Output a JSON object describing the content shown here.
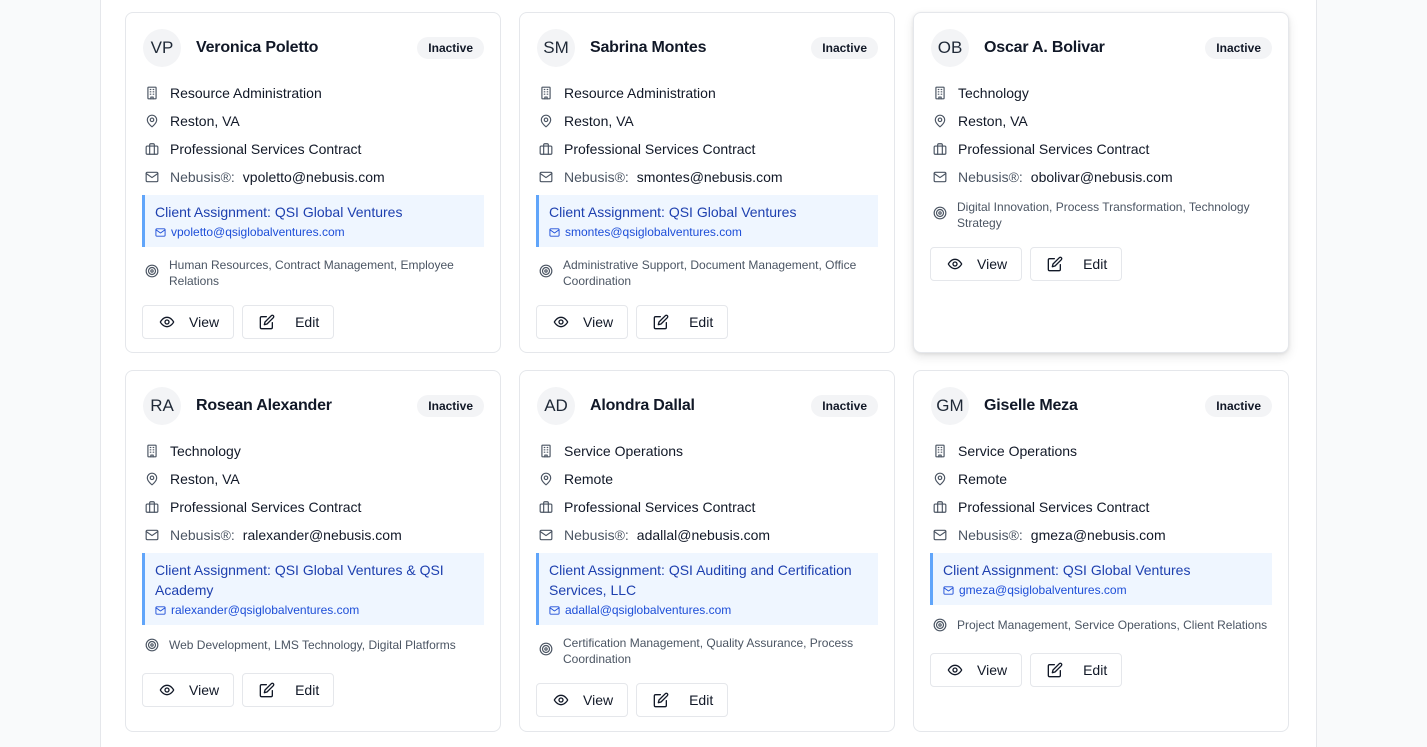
{
  "icons": {
    "department": "building-icon",
    "location": "map-pin-icon",
    "contract": "briefcase-icon",
    "email": "mail-icon",
    "skills": "target-icon",
    "view": "eye-icon",
    "edit": "edit-icon"
  },
  "colors": {
    "assignment_bg": "#eff6ff",
    "assignment_border": "#60a5fa",
    "assignment_text": "#1e40af"
  },
  "labels": {
    "nebusis": "Nebusis®:",
    "view": "View",
    "edit": "Edit",
    "assignment_prefix": "Client Assignment:"
  },
  "cards": [
    {
      "initials": "VP",
      "name": "Veronica Poletto",
      "status": "Inactive",
      "department": "Resource Administration",
      "location": "Reston, VA",
      "contract": "Professional Services Contract",
      "nebusis_email": "vpoletto@nebusis.com",
      "assignment": "Client Assignment: QSI Global Ventures",
      "assignment_email": "vpoletto@qsiglobalventures.com",
      "skills": "Human Resources, Contract Management, Employee Relations"
    },
    {
      "initials": "SM",
      "name": "Sabrina Montes",
      "status": "Inactive",
      "department": "Resource Administration",
      "location": "Reston, VA",
      "contract": "Professional Services Contract",
      "nebusis_email": "smontes@nebusis.com",
      "assignment": "Client Assignment: QSI Global Ventures",
      "assignment_email": "smontes@qsiglobalventures.com",
      "skills": "Administrative Support, Document Management, Office Coordination"
    },
    {
      "initials": "OB",
      "name": "Oscar A. Bolivar",
      "status": "Inactive",
      "department": "Technology",
      "location": "Reston, VA",
      "contract": "Professional Services Contract",
      "nebusis_email": "obolivar@nebusis.com",
      "skills": "Digital Innovation, Process Transformation, Technology Strategy"
    },
    {
      "initials": "RA",
      "name": "Rosean Alexander",
      "status": "Inactive",
      "department": "Technology",
      "location": "Reston, VA",
      "contract": "Professional Services Contract",
      "nebusis_email": "ralexander@nebusis.com",
      "assignment": "Client Assignment: QSI Global Ventures & QSI Academy",
      "assignment_email": "ralexander@qsiglobalventures.com",
      "skills": "Web Development, LMS Technology, Digital Platforms"
    },
    {
      "initials": "AD",
      "name": "Alondra Dallal",
      "status": "Inactive",
      "department": "Service Operations",
      "location": "Remote",
      "contract": "Professional Services Contract",
      "nebusis_email": "adallal@nebusis.com",
      "assignment": "Client Assignment: QSI Auditing and Certification Services, LLC",
      "assignment_email": "adallal@qsiglobalventures.com",
      "skills": "Certification Management, Quality Assurance, Process Coordination"
    },
    {
      "initials": "GM",
      "name": "Giselle Meza",
      "status": "Inactive",
      "department": "Service Operations",
      "location": "Remote",
      "contract": "Professional Services Contract",
      "nebusis_email": "gmeza@nebusis.com",
      "assignment": "Client Assignment: QSI Global Ventures",
      "assignment_email": "gmeza@qsiglobalventures.com",
      "skills": "Project Management, Service Operations, Client Relations"
    }
  ]
}
